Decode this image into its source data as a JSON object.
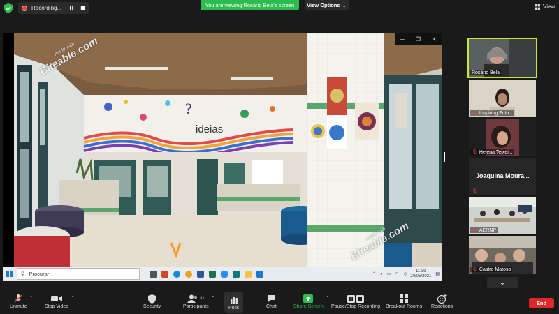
{
  "recording": {
    "label": "Recording...",
    "pause_icon": "pause-icon",
    "stop_icon": "stop-icon"
  },
  "banner": {
    "viewing_text": "You are viewing Rosário Bela's screen",
    "view_options_label": "View Options"
  },
  "view_button": {
    "label": "View"
  },
  "shared_screen": {
    "watermark_small": "made with",
    "watermark_big": "Biteable.com",
    "taskbar": {
      "search_placeholder": "Procurar",
      "time": "11:39",
      "date": "20/05/2021"
    }
  },
  "participants": [
    {
      "name": "Rosário Bela",
      "active": true,
      "muted": false
    },
    {
      "name": "Inspiring Futu...",
      "active": false,
      "muted": true
    },
    {
      "name": "Helena Teixei...",
      "active": false,
      "muted": true
    },
    {
      "name": "Joaquina  Moura...",
      "active": false,
      "muted": true
    },
    {
      "name": "AERNP",
      "active": false,
      "muted": true
    },
    {
      "name": "Castro Matoso",
      "active": false,
      "muted": true
    }
  ],
  "toolbar": {
    "unmute": "Unmute",
    "stop_video": "Stop Video",
    "security": "Security",
    "participants": "Participants",
    "participants_count": "31",
    "polls": "Polls",
    "chat": "Chat",
    "share_screen": "Share Screen",
    "recording": "Pause/Stop Recording",
    "breakout": "Breakout Rooms",
    "reactions": "Reactions",
    "end": "End"
  },
  "colors": {
    "accent_green": "#2dbd4f",
    "end_red": "#e02828",
    "active_border": "#c5e832",
    "share_screen_green": "#2dbd4f"
  }
}
